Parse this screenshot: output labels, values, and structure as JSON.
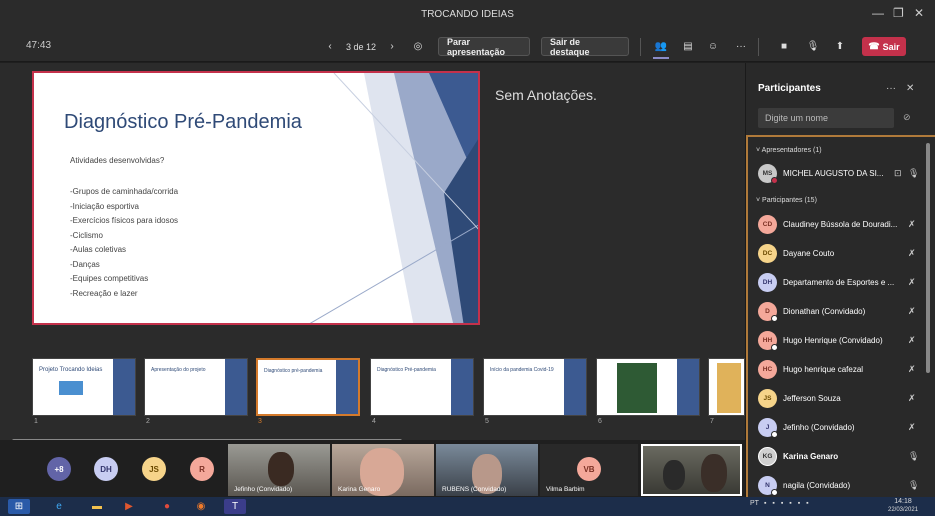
{
  "window": {
    "title": "TROCANDO IDEIAS"
  },
  "toolbar": {
    "timer": "47:43",
    "page_indicator": "3 de 12",
    "present_button": "Parar apresentação",
    "spotlight_button": "Sair de destaque",
    "leave_button": "Sair"
  },
  "slide": {
    "title": "Diagnóstico Pré-Pandemia",
    "subtitle": "Atividades desenvolvidas?",
    "items": [
      "-Grupos de caminhada/corrida",
      "-Iniciação esportiva",
      "-Exercícios físicos para idosos",
      "-Ciclismo",
      "-Aulas coletivas",
      "-Danças",
      "-Equipes competitivas",
      "-Recreação e lazer"
    ]
  },
  "notes": {
    "text": "Sem Anotações."
  },
  "thumbnails": [
    {
      "num": "1",
      "title": "Projeto Trocando Ideias"
    },
    {
      "num": "2",
      "title": "Apresentação do projeto"
    },
    {
      "num": "3",
      "title": "Diagnóstico pré-pandemia"
    },
    {
      "num": "4",
      "title": "Diagnóstico Pré-pandemia"
    },
    {
      "num": "5",
      "title": "Início da pandemia Covid-19"
    },
    {
      "num": "6",
      "title": ""
    },
    {
      "num": "7",
      "title": ""
    }
  ],
  "panel": {
    "title": "Participantes",
    "search_placeholder": "Digite um nome",
    "presenters_label": "Apresentadores (1)",
    "participants_label": "Participantes (15)",
    "presenters": [
      {
        "initials": "MS",
        "name": "MICHEL AUGUSTO DA SI...",
        "color": "#c8c8c8"
      }
    ],
    "participants": [
      {
        "initials": "CD",
        "name": "Claudiney Bússola de Douradi...",
        "color": "#f4a89a"
      },
      {
        "initials": "DC",
        "name": "Dayane Couto",
        "color": "#f6d48a"
      },
      {
        "initials": "DH",
        "name": "Departamento de Esportes e ...",
        "color": "#c8cdf2"
      },
      {
        "initials": "D",
        "name": "Dionathan (Convidado)",
        "color": "#f4a89a"
      },
      {
        "initials": "HH",
        "name": "Hugo Henrique (Convidado)",
        "color": "#f4a89a"
      },
      {
        "initials": "HC",
        "name": "Hugo henrique cafezal",
        "color": "#f4a89a"
      },
      {
        "initials": "JS",
        "name": "Jefferson Souza",
        "color": "#f6d48a"
      },
      {
        "initials": "J",
        "name": "Jefinho (Convidado)",
        "color": "#c8cdf2"
      },
      {
        "initials": "KG",
        "name": "Karina Genaro",
        "color": "#d0d0d0"
      },
      {
        "initials": "N",
        "name": "nagila (Convidado)",
        "color": "#c8cdf2"
      }
    ]
  },
  "strip": {
    "avatars": [
      {
        "label": "+8",
        "color": "#6264a7"
      },
      {
        "label": "DH",
        "color": "#c8cdf2"
      },
      {
        "label": "JS",
        "color": "#f6d48a"
      },
      {
        "label": "R",
        "color": "#f4a89a"
      }
    ],
    "videos": [
      {
        "name": "Jefinho (Convidado)"
      },
      {
        "name": "Karina Genaro"
      },
      {
        "name": "RUBENS (Convidado)"
      },
      {
        "name": "Vilma Barbim",
        "initials": "VB"
      }
    ]
  },
  "taskbar": {
    "lang": "PT",
    "time": "14:18",
    "date": "22/03/2021"
  }
}
